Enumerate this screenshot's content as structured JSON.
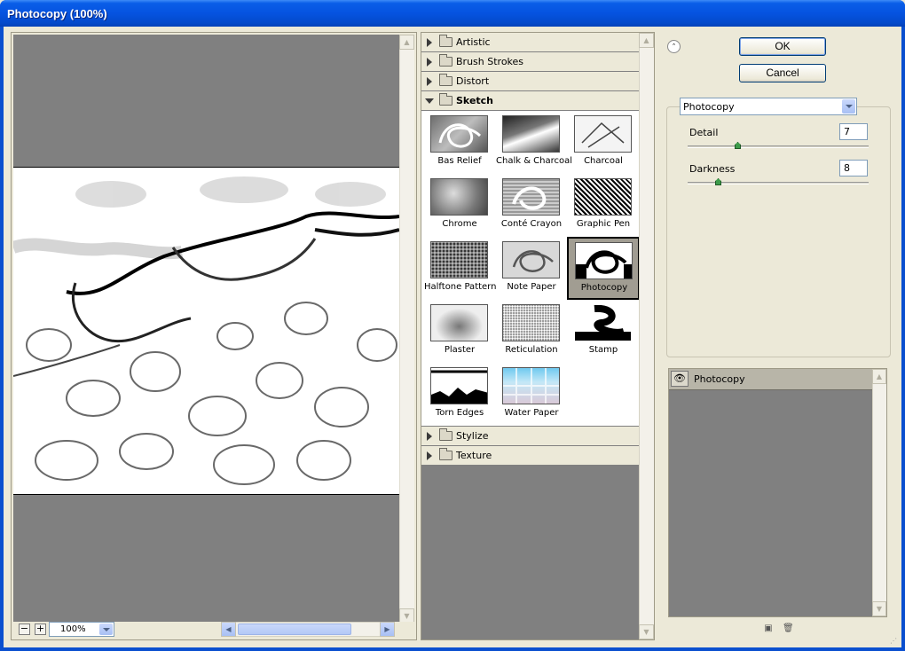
{
  "window": {
    "title": "Photocopy (100%)"
  },
  "preview": {
    "zoom_out_label": "−",
    "zoom_in_label": "+",
    "zoom_value": "100%"
  },
  "gallery": {
    "categories_top": [
      {
        "label": "Artistic"
      },
      {
        "label": "Brush Strokes"
      },
      {
        "label": "Distort"
      }
    ],
    "open_category": {
      "label": "Sketch"
    },
    "filters": [
      {
        "label": "Bas Relief"
      },
      {
        "label": "Chalk & Charcoal"
      },
      {
        "label": "Charcoal"
      },
      {
        "label": "Chrome"
      },
      {
        "label": "Conté Crayon"
      },
      {
        "label": "Graphic Pen"
      },
      {
        "label": "Halftone Pattern"
      },
      {
        "label": "Note Paper"
      },
      {
        "label": "Photocopy"
      },
      {
        "label": "Plaster"
      },
      {
        "label": "Reticulation"
      },
      {
        "label": "Stamp"
      },
      {
        "label": "Torn Edges"
      },
      {
        "label": "Water Paper"
      }
    ],
    "selected_filter": "Photocopy",
    "categories_bottom": [
      {
        "label": "Stylize"
      },
      {
        "label": "Texture"
      }
    ]
  },
  "actions": {
    "ok_label": "OK",
    "cancel_label": "Cancel"
  },
  "settings": {
    "filter_select_value": "Photocopy",
    "params": [
      {
        "label": "Detail",
        "value": "7",
        "fraction": 0.26
      },
      {
        "label": "Darkness",
        "value": "8",
        "fraction": 0.15
      }
    ]
  },
  "layers": {
    "items": [
      {
        "label": "Photocopy",
        "visible": true
      }
    ]
  },
  "colors": {
    "titlebar": "#0553e0",
    "dialog_bg": "#ece9d8",
    "canvas_gray": "#808080",
    "selected_thumb": "#a19d92"
  }
}
